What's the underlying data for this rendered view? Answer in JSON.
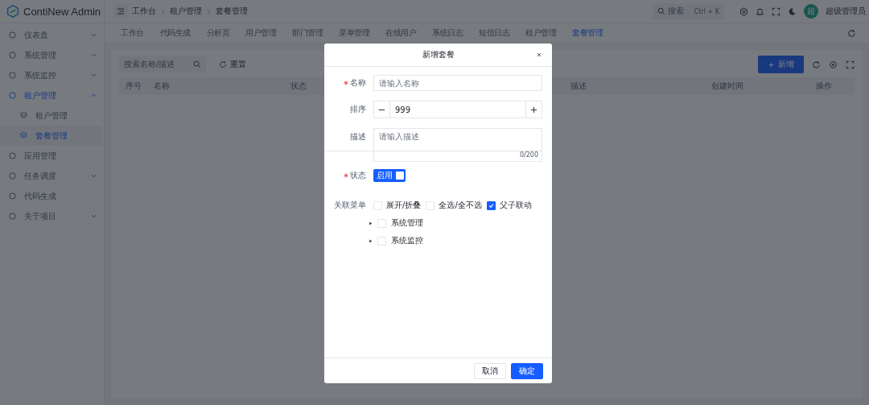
{
  "app": {
    "title": "ContiNew Admin"
  },
  "breadcrumb": [
    "工作台",
    "租户管理",
    "套餐管理"
  ],
  "header": {
    "search_placeholder": "搜索",
    "search_shortcut": "Ctrl + K",
    "user": {
      "avatar_text": "超",
      "name": "超级管理员"
    }
  },
  "sidebar": {
    "items": [
      {
        "label": "仪表盘",
        "expandable": true,
        "expanded": false,
        "selected": false
      },
      {
        "label": "系统管理",
        "expandable": true,
        "expanded": false,
        "selected": false
      },
      {
        "label": "系统监控",
        "expandable": true,
        "expanded": false,
        "selected": false
      },
      {
        "label": "租户管理",
        "expandable": true,
        "expanded": true,
        "selected": true,
        "children": [
          {
            "label": "租户管理",
            "selected": false
          },
          {
            "label": "套餐管理",
            "selected": true
          }
        ]
      },
      {
        "label": "应用管理",
        "expandable": false,
        "selected": false
      },
      {
        "label": "任务调度",
        "expandable": true,
        "expanded": false,
        "selected": false
      },
      {
        "label": "代码生成",
        "expandable": false,
        "selected": false
      },
      {
        "label": "关于项目",
        "expandable": true,
        "expanded": false,
        "selected": false
      }
    ]
  },
  "tabs": [
    {
      "label": "工作台",
      "selected": false
    },
    {
      "label": "代码生成",
      "selected": false
    },
    {
      "label": "分析页",
      "selected": false
    },
    {
      "label": "用户管理",
      "selected": false
    },
    {
      "label": "部门管理",
      "selected": false
    },
    {
      "label": "菜单管理",
      "selected": false
    },
    {
      "label": "在线用户",
      "selected": false
    },
    {
      "label": "系统日志",
      "selected": false
    },
    {
      "label": "短信日志",
      "selected": false
    },
    {
      "label": "租户管理",
      "selected": false
    },
    {
      "label": "套餐管理",
      "selected": true
    }
  ],
  "toolbar": {
    "search_placeholder": "搜索名称/描述",
    "reset": "重置",
    "add": "新增"
  },
  "table": {
    "columns_left": [
      "序号",
      "名称",
      "状态"
    ],
    "columns_right": [
      "描述",
      "创建时间",
      "操作"
    ]
  },
  "dialog": {
    "title": "新增套餐",
    "name": {
      "label": "名称",
      "required": true,
      "placeholder": "请输入名称"
    },
    "sort": {
      "label": "排序",
      "required": false,
      "value": "999"
    },
    "description": {
      "label": "描述",
      "required": false,
      "placeholder": "请输入描述",
      "count": "0/200"
    },
    "status": {
      "label": "状态",
      "required": true,
      "on": true,
      "text": "启用"
    },
    "menus": {
      "label": "关联菜单",
      "options": [
        {
          "label": "展开/折叠",
          "checked": false
        },
        {
          "label": "全选/全不选",
          "checked": false
        },
        {
          "label": "父子联动",
          "checked": true
        }
      ],
      "tree": [
        {
          "label": "系统管理",
          "expanded": false,
          "checked": false
        },
        {
          "label": "系统监控",
          "expanded": false,
          "checked": false
        }
      ]
    },
    "buttons": [
      {
        "label": "取消",
        "kind": "secondary"
      },
      {
        "label": "确定",
        "kind": "primary"
      }
    ]
  }
}
